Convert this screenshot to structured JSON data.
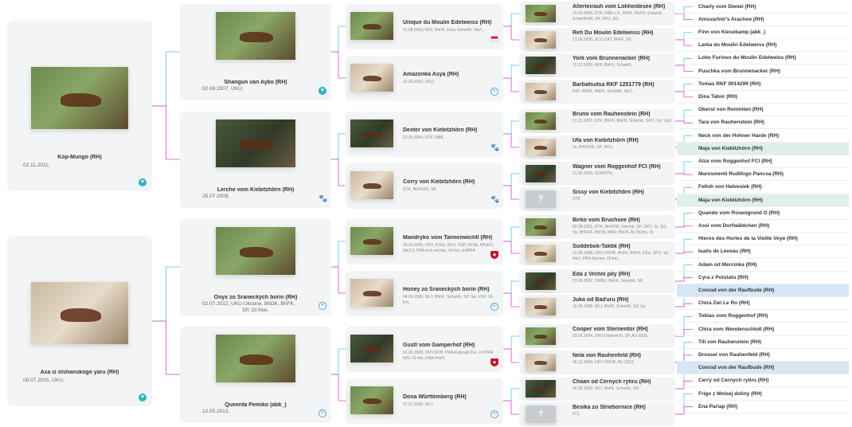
{
  "gen1": [
    {
      "name": "Kop-Mungo (RH)",
      "date": "02.11.2011,",
      "icon": "heart-icon"
    },
    {
      "name": "Axa iz olshanskogo yaru (RH)",
      "date": "08.07.2015, UKU,",
      "icon": "heart-icon"
    }
  ],
  "gen2": [
    {
      "name": "Shangun van Ayko (RH)",
      "date": "02.08.2007, UKU,",
      "icon": "heart-icon"
    },
    {
      "name": "Lerche vom Kiebitzhörn (RH)",
      "date": "25.07.2009,",
      "icon": "paw-icon"
    },
    {
      "name": "Onyx zo Šraneckých borín (RH)",
      "date": "02.07.2012, UKU-Ukraine, BhDK, BhFK,",
      "date2": "SP, OI free,",
      "icon": "globe-icon"
    },
    {
      "name": "Queenta Pemiko (abk_)",
      "date": "12.05.2013,",
      "icon": "globe-icon"
    }
  ],
  "gen3": [
    {
      "name": "Unique du Moulin Edelweiss (RH)",
      "info": "21.08.2003, RKF, BhFK, ESw, SchwhK, WaT,..",
      "icon": "flag-icon"
    },
    {
      "name": "Amazonka Asya (RH)",
      "info": "23.06.2004, UKU,",
      "icon": "globe-icon"
    },
    {
      "name": "Dexter von Kiebitzhörn (RH)",
      "info": "23.05.2004, DTK 1888,",
      "icon": "paw-icon"
    },
    {
      "name": "Corry von Kiebitzhörn (RH)",
      "info": "DTK, BhFK/95, SP,",
      "icon": "paw-icon"
    },
    {
      "name": "Mandryko vom Tannenwichtl (RH)",
      "info": "24.09.2005, ÖKV, FriVp, SP/J, VGP, APoE, APuE/J, WaT/J, PRA-Kat.vorl.frei, OI-frei, crdPRA",
      "icon": "shield-icon"
    },
    {
      "name": "Honey zo Šraneckých borín (RH)",
      "info": "04.06.2006, SKJ, BhFK, SchwhK, SP, Sw, VGP, OI-frei,",
      "icon": "globe-icon"
    },
    {
      "name": "Gustl vom Gamperhof (RH)",
      "info": "02.06.2008, ÖKV/VDH, PRA-Katarakt frei, crd PRA N/N, OI-frei, DNA-Profil,",
      "icon": "shield-icon"
    },
    {
      "name": "Dona Württemberg (RH)",
      "info": "27.07.2005, SKJ,",
      "icon": "globe-icon"
    }
  ],
  "gen4": [
    {
      "name": "Allerleirauh vom Lohheidesee (RH)",
      "info": "10.03.2000, DTK 1888 e.V., BhFK, BhFN, SchwhK, SchwhK/40, SP, SP/J, StJ,"
    },
    {
      "name": "Reh Du Moulin Edelweiss (RH)",
      "info": "17.05.2000, SCC-CAT, BhFK, SP,"
    },
    {
      "name": "York vom Brunnenacker (RH)",
      "info": "10.12.1999, RKF, BhFK, SchwhK,"
    },
    {
      "name": "Barbatsutsa RKF 1251779 (RH)",
      "info": "RKF, BhDK, BhFK, SchwhK, WaT,.."
    },
    {
      "name": "Bruno vom Rauhenstein (RH)",
      "info": "21.11.1997, DTK, BhFK, BhFN, SchwhK, SP/J, Vp, Vp/J,"
    },
    {
      "name": "Ufa von Kiebitzhörn (RH)",
      "info": "Ja, BhFK/95, SP, SP/J,"
    },
    {
      "name": "Wagner vom Roggenhof FCI (RH)",
      "info": "21.06.2000, VDH/DTK,"
    },
    {
      "name": "Sissy von Kiebitzhörn (RH)",
      "info": "DTK"
    },
    {
      "name": "Birko vom Bruchsee (RH)",
      "info": "02.08.2001, DTK, BhFK95, InterVp, SP, SP/J, St, StJ, Vp, BhFK/F, BhDN, MRV, BhFN, AU BJdrv, OI"
    },
    {
      "name": "Suddebok-Taktik (RH)",
      "info": "31.08.1998, ÖKV-ÖDHK, BhFK, BhFN, ESw, SP/J, Vp, WaT, PRA-Kat.frei, OI frei,"
    },
    {
      "name": "Eda z Vrchní pily (RH)",
      "info": "01.06.2002, CMKU, BhFK, SchwhK, SP,"
    },
    {
      "name": "Juka od Baďuru (RH)",
      "info": "15.05.1998, SKJ, BhFK, SchwhK, SP, Vp,"
    },
    {
      "name": "Cooper vom Sternentor (RH)",
      "info": "03.05.2004, ÖKV-Österreich, SP, AU 2008,"
    },
    {
      "name": "Nela von Rauhenfeld (RH)",
      "info": "06.12.2004, ÖKV-ÖDHK, AU 2013,"
    },
    {
      "name": "Chaan od Cernych rytiru (RH)",
      "info": "06.05.1999, SKJ, BhFK, SchwhK, SP,"
    },
    {
      "name": "Besika zo Striebornice (RH)",
      "info": "FCI,"
    }
  ],
  "gen5": [
    "Charly vom Dienei (RH)",
    "Amsvartnir's Arachne (RH)",
    "Finn von Kiesekamp (abk_)",
    "Larka du Moulin Edelweiss (RH)",
    "Lobo Furioso du Moulin Edelweiss (RH)",
    "Puschka vom Brunnenacker (RH)",
    "Tomas RKF 0014299 (RH)",
    "Dina Tabor (RH)",
    "Oberst von Rominten (RH)",
    "Tara von Rauhenstein (RH)",
    "Neck von der Hohner Harde (RH)",
    "Maja von Kiebitzhörn (RH)",
    "Atze vom Roggenhof FCI (RH)",
    "Marosmenti Rudifogo Pancsa (RH)",
    "Felloh von Helvesiek (RH)",
    "Maja von Kiebitzhörn (RH)",
    "Quando vom Rosengrund O (RH)",
    "Assi vom Dorfwäldchen (RH)",
    "Hieros des Horles de la Vieille Voye (RH)",
    "Isatis de Leveau (RH)",
    "Adam od Mercinka (RH)",
    "Cyra z Potstatu (RH)",
    "Conrad von der Raufbude (RH)",
    "Chira Zwi Le Ro (RH)",
    "Tobias vom Roggenhof (RH)",
    "Chira vom Wendenschloß (RH)",
    "Till von Rauhenstein (RH)",
    "Drossel von Rauhenfeld (RH)",
    "Conrad von der Raufbude (RH)",
    "Cerry od Cernych rytiru (RH)",
    "Frigo z Mnisej doliny (RH)",
    "Ena Parlap (RH)"
  ],
  "colors": {
    "male_line": "#5bc0de",
    "female_line": "#d946c8",
    "highlight_teal": "#dff0ec",
    "highlight_blue": "#d6e6f5"
  }
}
